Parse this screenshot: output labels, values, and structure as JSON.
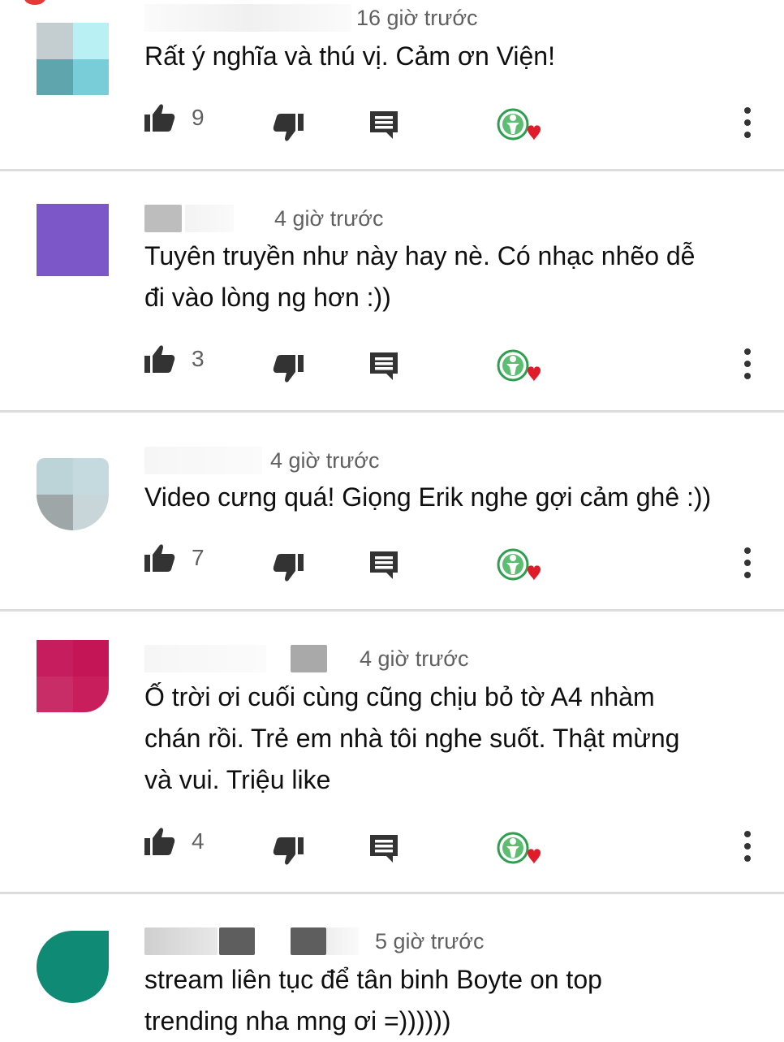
{
  "colors": {
    "text": "#0f0f0f",
    "secondary": "#606060",
    "icon": "#333333",
    "heart": "#e01b2a",
    "badge_green": "#2e9e4f",
    "divider": "#dcdcdc"
  },
  "comments": [
    {
      "time": "16 giờ trước",
      "text": "Rất ý nghĩa và thú vị. Cảm ơn Viện!",
      "likes": "9"
    },
    {
      "time": "4 giờ trước",
      "text": "Tuyên truyền như này hay nè. Có nhạc nhẽo dễ\nđi vào lòng ng hơn :))",
      "likes": "3"
    },
    {
      "time": "4 giờ trước",
      "text": "Video cưng quá! Giọng Erik nghe gợi cảm ghê :))",
      "likes": "7"
    },
    {
      "time": "4 giờ trước",
      "text": "Ố trời ơi cuối cùng cũng chịu bỏ tờ A4 nhàm\nchán rồi. Trẻ em nhà tôi nghe suốt. Thật mừng\nvà vui. Triệu like",
      "likes": "4"
    },
    {
      "time": "5 giờ trước",
      "text": "stream liên tục để tân binh Boyte on top\ntrending nha mng ơi =))))))",
      "likes": ""
    }
  ],
  "icons": {
    "like": "thumb-up-icon",
    "dislike": "thumb-down-icon",
    "reply": "reply-comment-icon",
    "creator_heart": "creator-heart-badge-icon",
    "more": "more-vertical-icon"
  }
}
